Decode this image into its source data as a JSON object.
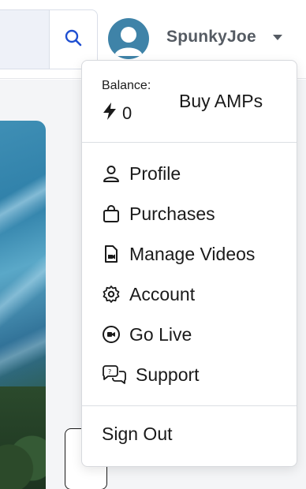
{
  "header": {
    "username": "SpunkyJoe"
  },
  "menu": {
    "balance_label": "Balance:",
    "balance_value": "0",
    "buy_amps": "Buy AMPs",
    "items": [
      {
        "label": "Profile",
        "icon": "user-icon"
      },
      {
        "label": "Purchases",
        "icon": "shopping-bag-icon"
      },
      {
        "label": "Manage Videos",
        "icon": "video-file-icon"
      },
      {
        "label": "Account",
        "icon": "gear-icon"
      },
      {
        "label": "Go Live",
        "icon": "live-camera-icon"
      },
      {
        "label": "Support",
        "icon": "chat-bubbles-icon"
      }
    ],
    "sign_out": "Sign Out"
  },
  "colors": {
    "accent": "#1f4fd1",
    "avatar_bg": "#3f83a8",
    "username": "#555b63"
  }
}
